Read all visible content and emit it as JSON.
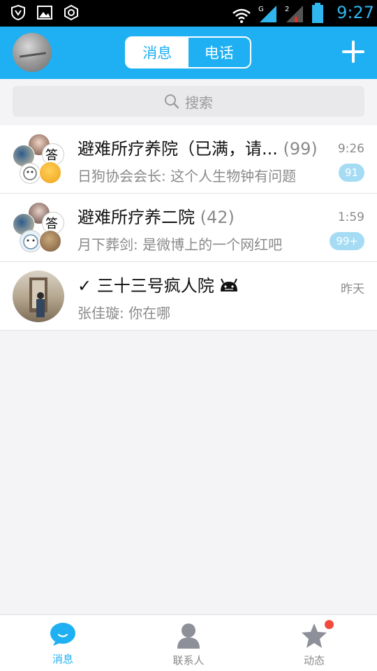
{
  "status_bar": {
    "time": "9:27",
    "icons": [
      "shield-icon",
      "gallery-icon",
      "settings-ring-icon",
      "wifi-icon",
      "signal-g-icon",
      "signal-2-icon",
      "battery-icon"
    ]
  },
  "header": {
    "segment": {
      "messages_label": "消息",
      "calls_label": "电话",
      "active": "消息"
    },
    "add_icon": "plus-icon",
    "accent_color": "#1eb0f2"
  },
  "search": {
    "placeholder": "搜索"
  },
  "conversations": [
    {
      "title": "避难所疗养院（已满，请...",
      "count": "(99)",
      "last_message": "日狗协会会长: 这个人生物钟有问题",
      "time": "9:26",
      "badge": "91"
    },
    {
      "title": "避难所疗养二院",
      "count": "(42)",
      "last_message": "月下葬剑: 是微博上的一个网红吧",
      "time": "1:59",
      "badge": "99+"
    },
    {
      "title": "✓ 三十三号疯人院",
      "count": "",
      "last_message": "张佳璇: 你在哪",
      "time": "昨天",
      "badge": ""
    }
  ],
  "bottom_nav": {
    "items": [
      {
        "label": "消息",
        "icon": "chat-bubble-icon",
        "active": true
      },
      {
        "label": "联系人",
        "icon": "contact-person-icon",
        "active": false
      },
      {
        "label": "动态",
        "icon": "star-icon",
        "active": false,
        "has_dot": true
      }
    ]
  }
}
